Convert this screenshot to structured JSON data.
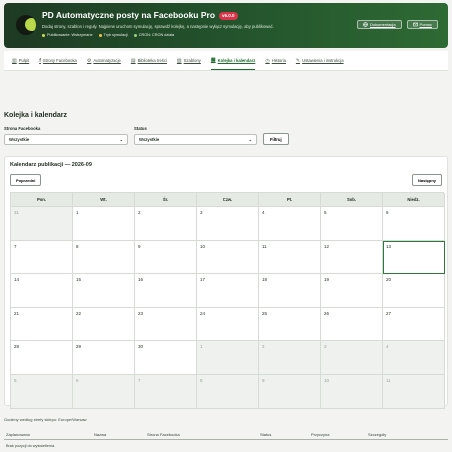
{
  "header": {
    "title": "PD Automatyczne posty na Facebooku Pro",
    "version": "v6.0.0",
    "description": "Dodaj strony, szablon i reguły. Najpierw uruchom symulację, sprawdź kolejkę, a następnie wyłącz symulację, aby publikować.",
    "badges": [
      {
        "label": "Publikowanie: Wstrzymane",
        "color": "#c9e05a"
      },
      {
        "label": "Tryb symulacji",
        "color": "#f0c63a"
      },
      {
        "label": "CRON: CRON działa",
        "color": "#9ad17a"
      }
    ],
    "buttons": {
      "docs": "Dokumentacja",
      "support": "Pomoc"
    }
  },
  "tabs": [
    {
      "label": "Pulpit",
      "icon": "dashboard-icon"
    },
    {
      "label": "Strony Facebooka",
      "icon": "facebook-icon"
    },
    {
      "label": "Automatyzacje",
      "icon": "automation-icon"
    },
    {
      "label": "Biblioteka treści",
      "icon": "library-icon"
    },
    {
      "label": "Szablony",
      "icon": "template-icon"
    },
    {
      "label": "Kolejka i kalendarz",
      "icon": "calendar-icon",
      "active": true
    },
    {
      "label": "Historia",
      "icon": "history-icon"
    },
    {
      "label": "Ustawienia i instrukcja",
      "icon": "settings-icon"
    }
  ],
  "section": {
    "title": "Kolejka i kalendarz",
    "filter_page_label": "Strona Facebooka",
    "filter_page_value": "Wszystkie",
    "filter_status_label": "Status",
    "filter_status_value": "Wszystkie",
    "filter_button": "Filtruj"
  },
  "calendar": {
    "title": "Kalendarz publikacji — 2026-09",
    "prev": "Poprzedni",
    "next": "Następny",
    "weekdays": [
      "Pon.",
      "Wt.",
      "Śr.",
      "Czw.",
      "Pt.",
      "Sob.",
      "Niedz."
    ],
    "days": [
      {
        "d": "31",
        "out": true
      },
      {
        "d": "1"
      },
      {
        "d": "2"
      },
      {
        "d": "3"
      },
      {
        "d": "4"
      },
      {
        "d": "5"
      },
      {
        "d": "6"
      },
      {
        "d": "7"
      },
      {
        "d": "8"
      },
      {
        "d": "9"
      },
      {
        "d": "10"
      },
      {
        "d": "11"
      },
      {
        "d": "12"
      },
      {
        "d": "13",
        "today": true
      },
      {
        "d": "14"
      },
      {
        "d": "15"
      },
      {
        "d": "16"
      },
      {
        "d": "17"
      },
      {
        "d": "18"
      },
      {
        "d": "19"
      },
      {
        "d": "20"
      },
      {
        "d": "21"
      },
      {
        "d": "22"
      },
      {
        "d": "23"
      },
      {
        "d": "24"
      },
      {
        "d": "25"
      },
      {
        "d": "26"
      },
      {
        "d": "27"
      },
      {
        "d": "28"
      },
      {
        "d": "29"
      },
      {
        "d": "30"
      },
      {
        "d": "1",
        "out": true
      },
      {
        "d": "2",
        "out": true
      },
      {
        "d": "3",
        "out": true
      },
      {
        "d": "4",
        "out": true
      },
      {
        "d": "5",
        "out": true
      },
      {
        "d": "6",
        "out": true
      },
      {
        "d": "7",
        "out": true
      },
      {
        "d": "8",
        "out": true
      },
      {
        "d": "9",
        "out": true
      },
      {
        "d": "10",
        "out": true
      },
      {
        "d": "11",
        "out": true
      }
    ]
  },
  "timezone_note": "Godziny według strefy sklepu: Europe/Warsaw",
  "table": {
    "columns": [
      "Zaplanowano",
      "Nazwa",
      "Strona Facebooka",
      "Status",
      "Przyczyna",
      "Szczegóły"
    ],
    "empty": "Brak pozycji do wyświetlenia."
  }
}
